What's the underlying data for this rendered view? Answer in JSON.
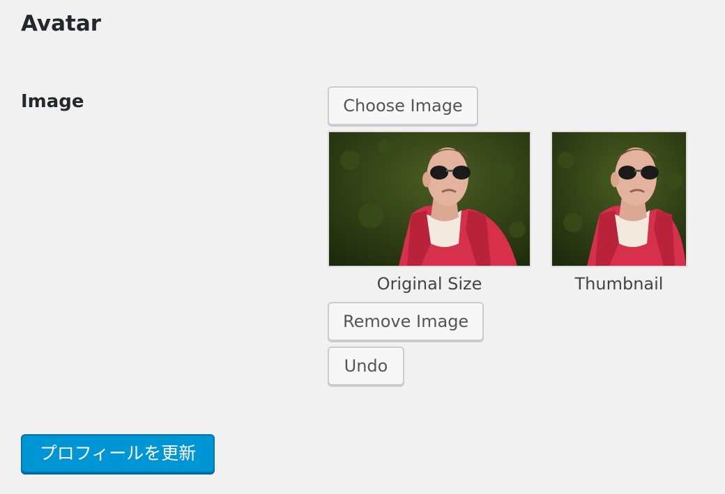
{
  "section": {
    "title": "Avatar"
  },
  "image_field": {
    "label": "Image",
    "choose_button": "Choose Image",
    "previews": {
      "original_caption": "Original Size",
      "thumbnail_caption": "Thumbnail"
    },
    "remove_button": "Remove Image",
    "undo_button": "Undo"
  },
  "submit": {
    "label": "プロフィールを更新"
  },
  "colors": {
    "background": "#f1f1f1",
    "primary_button": "#0096d6",
    "primary_border": "#0073aa",
    "secondary_button": "#f7f7f7",
    "text": "#23282d"
  }
}
